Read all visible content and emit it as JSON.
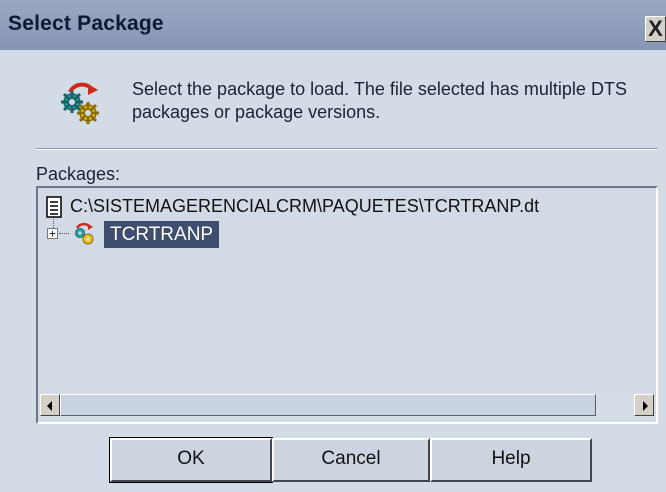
{
  "window": {
    "title": "Select Package",
    "close_glyph": "X"
  },
  "header": {
    "message": "Select the package to load.  The file selected has multiple DTS packages or package versions.",
    "icon": "package-gears-icon"
  },
  "packages": {
    "label": "Packages:",
    "tree": {
      "file": {
        "path": "C:\\SISTEMAGERENCIALCRM\\PAQUETES\\TCRTRANP.dt",
        "icon": "document-icon"
      },
      "package": {
        "name": "TCRTRANP",
        "expander": "+",
        "icon": "package-gears-icon",
        "selected": true
      }
    }
  },
  "buttons": {
    "ok": "OK",
    "cancel": "Cancel",
    "help": "Help"
  },
  "colors": {
    "title_bar": "#8695b3",
    "dialog_bg": "#d3dbe6",
    "selection": "#3e4e6e"
  }
}
